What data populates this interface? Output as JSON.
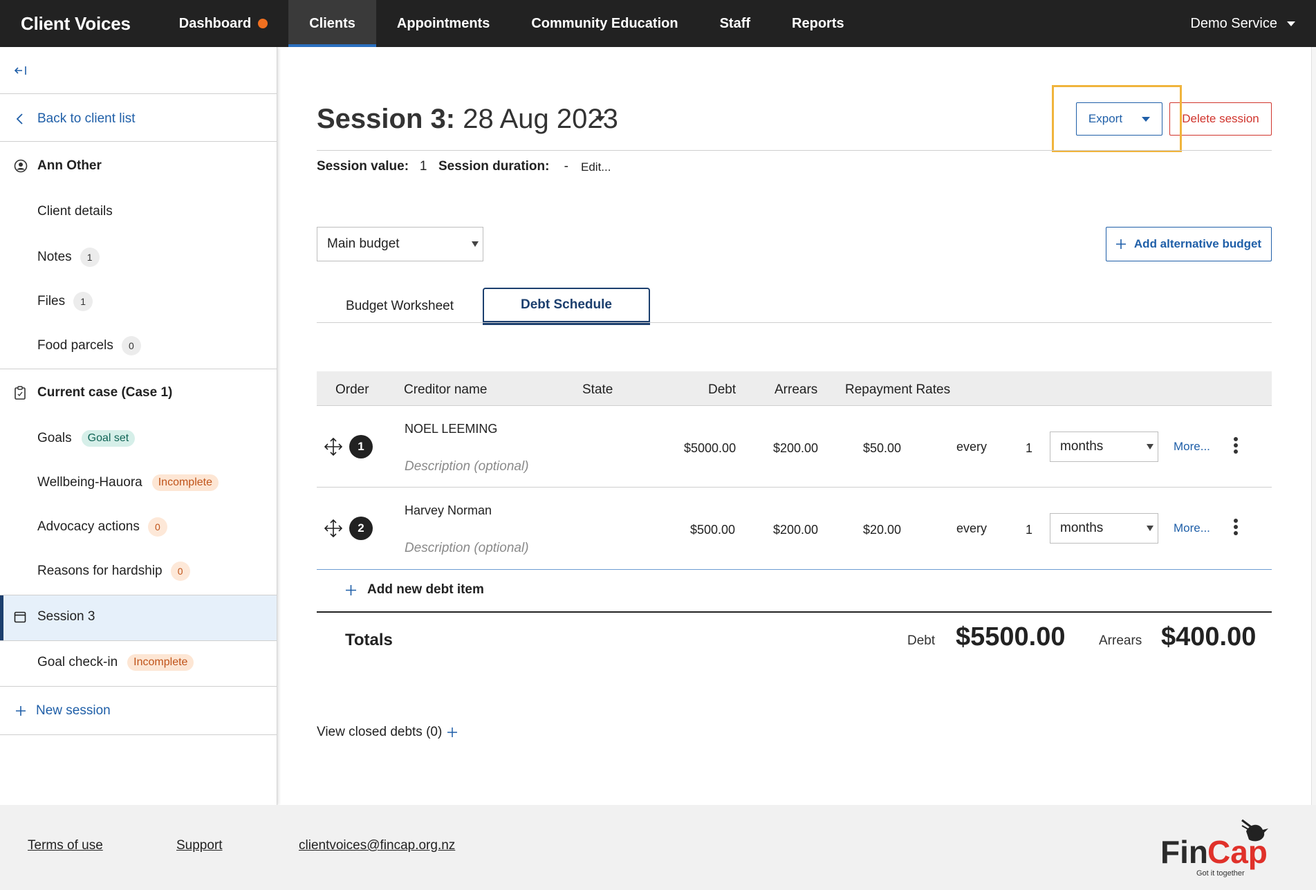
{
  "nav": {
    "brand": "Client Voices",
    "items": [
      {
        "label": "Dashboard"
      },
      {
        "label": "Clients"
      },
      {
        "label": "Appointments"
      },
      {
        "label": "Community Education"
      },
      {
        "label": "Staff"
      },
      {
        "label": "Reports"
      }
    ],
    "service": "Demo Service"
  },
  "sidebar": {
    "collapse_icon": "collapse-left-icon",
    "back": "Back to client list",
    "client_name": "Ann Other",
    "client_links": [
      {
        "label": "Client details"
      },
      {
        "label": "Notes",
        "count": "1"
      },
      {
        "label": "Files",
        "count": "1"
      },
      {
        "label": "Food parcels",
        "count": "0"
      }
    ],
    "case_title": "Current case (Case 1)",
    "case_links": [
      {
        "label": "Goals",
        "tag": "Goal set"
      },
      {
        "label": "Wellbeing-Hauora",
        "tag": "Incomplete"
      },
      {
        "label": "Advocacy actions",
        "count": "0"
      },
      {
        "label": "Reasons for hardship",
        "count": "0"
      }
    ],
    "session_title": "Session 3",
    "session_links": [
      {
        "label": "Goal check-in",
        "tag": "Incomplete"
      }
    ],
    "new_session": "New session"
  },
  "main": {
    "title_bold": "Session 3:",
    "title_rest": " 28 Aug 2023",
    "export_label": "Export",
    "delete_label": "Delete session",
    "session_value_label": "Session value:",
    "session_value": "1",
    "session_duration_label": "Session duration:",
    "session_duration": "-",
    "edit_label": "Edit...",
    "budget_select": "Main budget",
    "add_budget": "Add alternative budget",
    "tabs": [
      {
        "label": "Budget Worksheet"
      },
      {
        "label": "Debt Schedule"
      }
    ],
    "active_tab": "Debt Schedule",
    "columns": [
      "Order",
      "Creditor name",
      "State",
      "Debt",
      "Arrears",
      "Repayment Rates"
    ],
    "rows": [
      {
        "order": "1",
        "creditor": "NOEL LEEMING",
        "description": "Description (optional)",
        "debt": "$5000.00",
        "arrears": "$200.00",
        "rate": "$50.00",
        "every": "every",
        "freq": "1",
        "period": "months",
        "more": "More..."
      },
      {
        "order": "2",
        "creditor": "Harvey Norman",
        "description": "Description (optional)",
        "debt": "$500.00",
        "arrears": "$200.00",
        "rate": "$20.00",
        "every": "every",
        "freq": "1",
        "period": "months",
        "more": "More..."
      }
    ],
    "add_debt": "Add new debt item",
    "totals_label": "Totals",
    "debt_label": "Debt",
    "debt_total": "$5500.00",
    "arrears_label": "Arrears",
    "arrears_total": "$400.00",
    "closed_debts": "View closed debts (0)"
  },
  "footer": {
    "links": [
      "Terms of use",
      "Support",
      "clientvoices@fincap.org.nz"
    ],
    "logo_text": "FinCap",
    "logo_tagline": "Got it together"
  },
  "colors": {
    "nav_bg": "#222222",
    "link_blue": "#1f5fa8",
    "danger_red": "#d0342c",
    "highlight": "#f0b43c",
    "dashboard_dot": "#f07020"
  }
}
